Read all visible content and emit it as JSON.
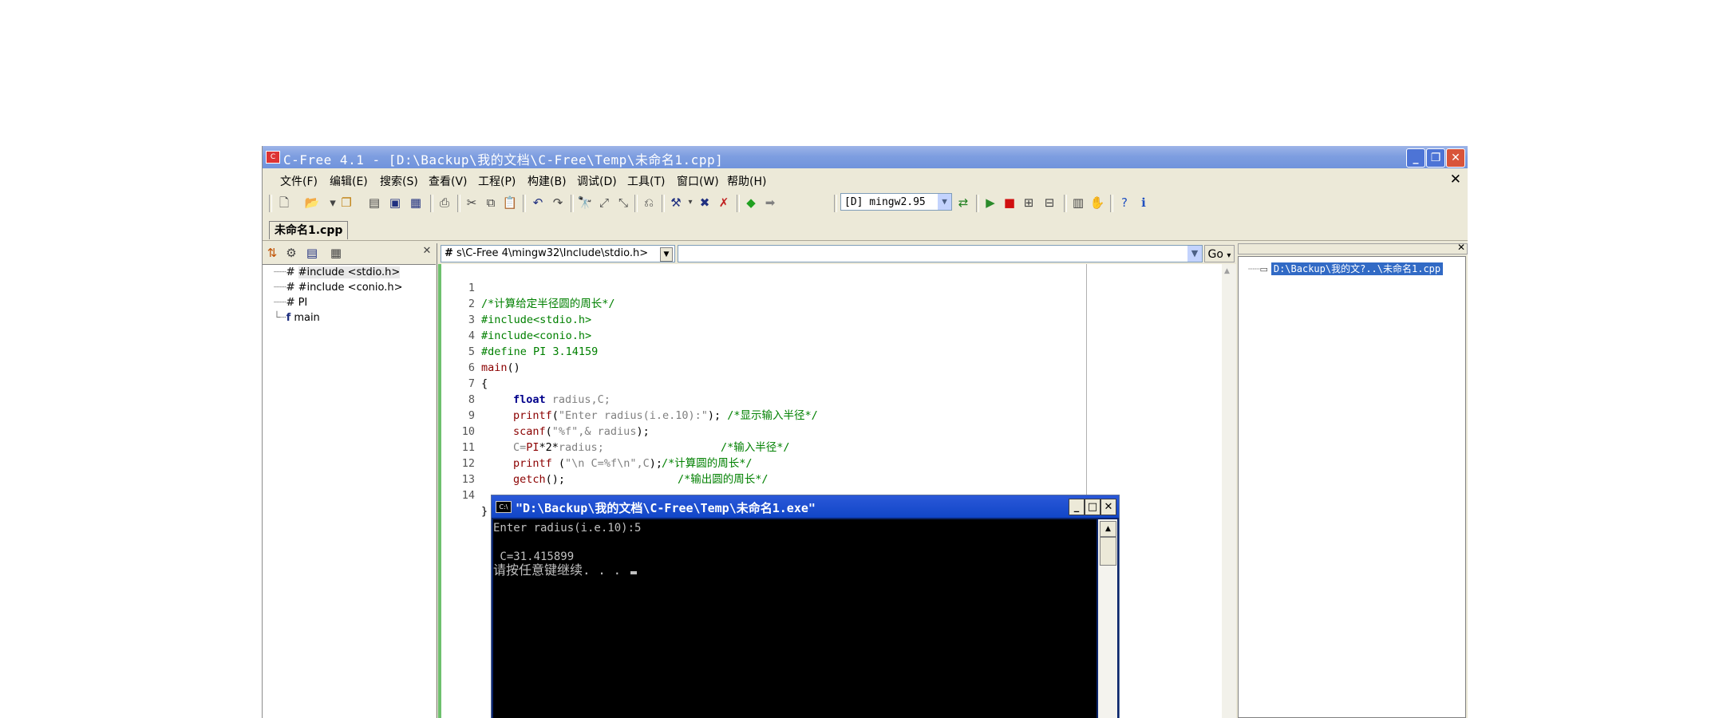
{
  "window": {
    "title": "C-Free 4.1 - [D:\\Backup\\我的文档\\C-Free\\Temp\\未命名1.cpp]",
    "app_icon": "cfree-app-icon",
    "minimize": "_",
    "restore": "❐",
    "close": "✕"
  },
  "menu": {
    "items": [
      "文件(F)",
      "编辑(E)",
      "搜索(S)",
      "查看(V)",
      "工程(P)",
      "构建(B)",
      "调试(D)",
      "工具(T)",
      "窗口(W)",
      "帮助(H)"
    ],
    "close_doc": "✕"
  },
  "toolbar": {
    "compiler": "[D] mingw2.95",
    "icons": [
      "new-file-icon",
      "open-icon",
      "open-project-icon",
      "close-icon",
      "save-icon",
      "save-all-icon",
      "print-icon",
      "cut-icon",
      "copy-icon",
      "paste-icon",
      "undo-icon",
      "redo-icon",
      "find-icon",
      "find-prev-icon",
      "find-next-icon",
      "replace-icon",
      "compile-icon",
      "build-icon",
      "rebuild-icon",
      "back-icon",
      "forward-icon",
      "compiler-settings-icon",
      "run-icon",
      "stop-icon",
      "debug-icon",
      "step-icon",
      "bookmark-icon",
      "hand-icon",
      "help-icon",
      "about-icon"
    ]
  },
  "tabs": {
    "file_tab": "未命名1.cpp"
  },
  "class_panel": {
    "items": [
      {
        "icon": "#",
        "label": "#include <stdio.h>"
      },
      {
        "icon": "#",
        "label": "#include <conio.h>"
      },
      {
        "icon": "#",
        "label": "PI"
      },
      {
        "icon": "f",
        "label": "main"
      }
    ]
  },
  "editor": {
    "include_combo": "s\\C-Free 4\\mingw32\\Include\\stdio.h>",
    "go_label": "Go",
    "lines": [
      "1",
      "2",
      "3",
      "4",
      "5",
      "6",
      "7",
      "8",
      "9",
      "10",
      "11",
      "12",
      "13",
      "14"
    ],
    "code": {
      "l1": "/*计算给定半径圆的周长*/",
      "l2": "#include<stdio.h>",
      "l3": "#include<conio.h>",
      "l4": "#define PI 3.14159",
      "l5a": "main",
      "l5b": "()",
      "l6": "{",
      "l7a": "float",
      "l7b": " radius,C;",
      "l8a": "printf",
      "l8b": "(",
      "l8c": "\"Enter radius(i.e.10):\"",
      "l8d": ");",
      "l8e": " /*显示输入半径*/",
      "l9a": "scanf",
      "l9b": "(",
      "l9c": "\"%f\",& radius",
      "l9d": ");",
      "l9e": "/*输入半径*/",
      "l10a": "C=",
      "l10b": "PI",
      "l10c": "*2*",
      "l10d": "radius;",
      "l10e": "/*计算圆的周长*/",
      "l11a": "printf",
      "l11b": " (",
      "l11c": "\"\\n C=%f\\n\",C",
      "l11d": ");",
      "l11e": "/*输出圆的周长*/",
      "l12a": "getch",
      "l12b": "();",
      "l13": "",
      "l14": "}"
    }
  },
  "console": {
    "title": "\"D:\\Backup\\我的文档\\C-Free\\Temp\\未命名1.exe\"",
    "line1": "Enter radius(i.e.10):5",
    "line2": "",
    "line3": " C=31.415899",
    "line4": "请按任意键继续. . . "
  },
  "project_panel": {
    "file": "D:\\Backup\\我的文?..\\未命名1.cpp",
    "close": "✕"
  }
}
